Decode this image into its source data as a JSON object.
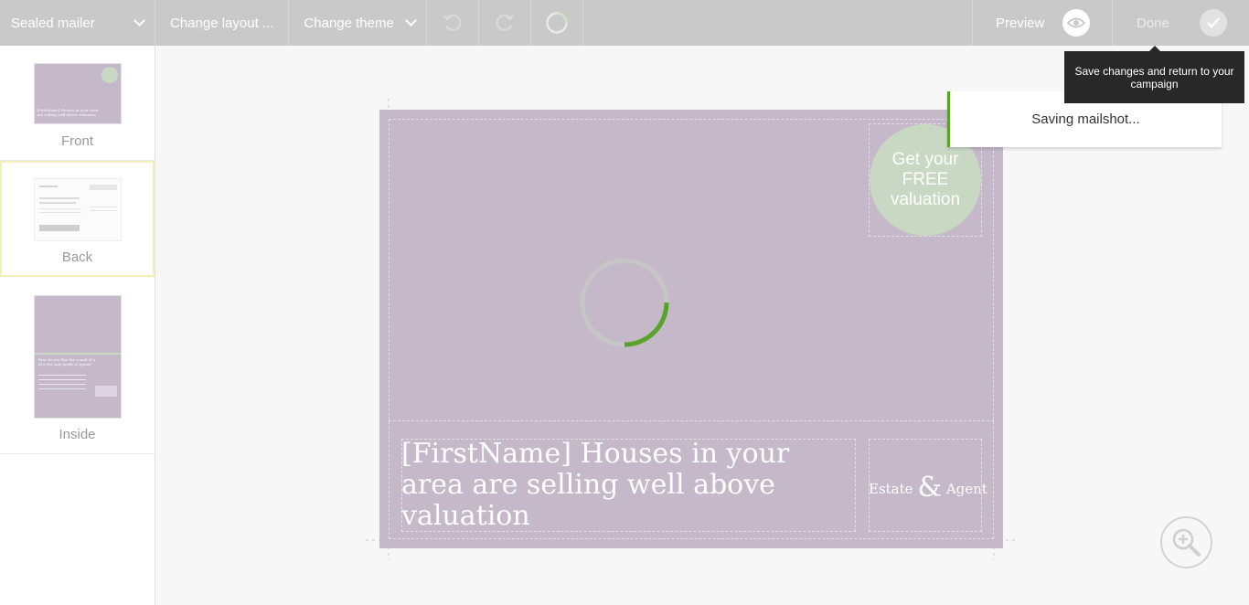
{
  "toolbar": {
    "product_select": "Sealed mailer",
    "change_layout_label": "Change layout ...",
    "change_theme_label": "Change theme",
    "preview_label": "Preview",
    "done_label": "Done"
  },
  "sidebar": {
    "pages": [
      {
        "label": "Front",
        "active": false
      },
      {
        "label": "Back",
        "active": true
      },
      {
        "label": "Inside",
        "active": false
      }
    ],
    "thumb_text": {
      "front_badge": "Get your FREE valuation",
      "front_headline": "[FirstName] Houses in your area are selling well above valuation",
      "inside_headline": "How do you like the sound of a £50,000 sale profit to spend?"
    }
  },
  "canvas": {
    "badge_text": "Get your FREE valuation",
    "headline": "[FirstName] Houses in your area are selling well above valuation",
    "logo_word1": "Estate",
    "logo_amp": "&",
    "logo_word2": "Agent",
    "background_color": "#c4b8c9",
    "badge_color": "#c8d8c2",
    "loading_progress": 0.25
  },
  "status": {
    "saving_text": "Saving mailshot...",
    "tooltip_text": "Save changes and return to your campaign"
  },
  "colors": {
    "toolbar_bg": "#c9c9c9",
    "accent_green": "#5aa32a",
    "active_page_border": "#f3f0b9"
  },
  "icons": {
    "undo": "undo-icon",
    "redo": "redo-icon",
    "loading": "loading-ring-icon",
    "preview": "eye-icon",
    "done": "check-icon",
    "zoom": "zoom-in-icon"
  }
}
